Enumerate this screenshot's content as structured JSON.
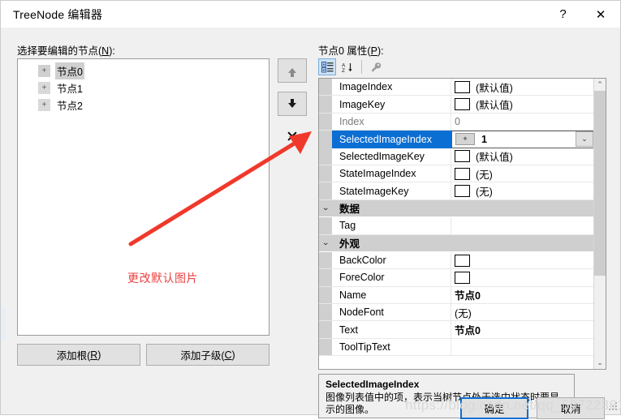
{
  "window": {
    "title": "TreeNode 编辑器",
    "help_label": "?",
    "close_label": "✕"
  },
  "left_pane": {
    "label": "选择要编辑的节点(N):",
    "label_prefix": "选择要编辑的节点(",
    "label_accel": "N",
    "label_suffix": "):",
    "tree_nodes": [
      {
        "label": "节点0",
        "expander": "+",
        "selected": true
      },
      {
        "label": "节点1",
        "expander": "+",
        "selected": false
      },
      {
        "label": "节点2",
        "expander": "+",
        "selected": false
      }
    ],
    "move_up_icon": "arrow-up-icon",
    "move_down_icon": "arrow-down-icon",
    "delete_icon": "x-delete-icon",
    "add_root": {
      "prefix": "添加根(",
      "accel": "R",
      "suffix": ")"
    },
    "add_child": {
      "prefix": "添加子级(",
      "accel": "C",
      "suffix": ")"
    }
  },
  "right_pane": {
    "label_prefix": "节点0 属性(",
    "label_accel": "P",
    "label_suffix": "):",
    "toolbar": {
      "categorized_icon": "categorized-view-icon",
      "alphabetical_icon": "alphabetical-sort-icon",
      "properties_icon": "wrench-properties-icon"
    },
    "rows": [
      {
        "type": "prop",
        "name": "ImageIndex",
        "value": "(默认值)",
        "swatch": true,
        "dim": false
      },
      {
        "type": "prop",
        "name": "ImageKey",
        "value": "(默认值)",
        "swatch": true,
        "dim": false
      },
      {
        "type": "prop",
        "name": "Index",
        "value": "0",
        "swatch": false,
        "dim": true
      },
      {
        "type": "edit",
        "name": "SelectedImageIndex",
        "value": "1",
        "imagebox": true,
        "dropdown": true
      },
      {
        "type": "prop",
        "name": "SelectedImageKey",
        "value": "(默认值)",
        "swatch": true,
        "dim": false
      },
      {
        "type": "prop",
        "name": "StateImageIndex",
        "value": "(无)",
        "swatch": true,
        "dim": false
      },
      {
        "type": "prop",
        "name": "StateImageKey",
        "value": "(无)",
        "swatch": true,
        "dim": false
      },
      {
        "type": "category",
        "name": "数据",
        "chevron": "⌄"
      },
      {
        "type": "prop",
        "name": "Tag",
        "value": "",
        "swatch": false,
        "dim": false
      },
      {
        "type": "category",
        "name": "外观",
        "chevron": "⌄"
      },
      {
        "type": "prop",
        "name": "BackColor",
        "value": "",
        "swatch": true,
        "dim": false
      },
      {
        "type": "prop",
        "name": "ForeColor",
        "value": "",
        "swatch": true,
        "dim": false
      },
      {
        "type": "prop",
        "name": "Name",
        "value": "节点0",
        "swatch": false,
        "dim": false,
        "bold": true
      },
      {
        "type": "prop",
        "name": "NodeFont",
        "value": "(无)",
        "swatch": false,
        "dim": false
      },
      {
        "type": "prop",
        "name": "Text",
        "value": "节点0",
        "swatch": false,
        "dim": false,
        "bold": true
      },
      {
        "type": "prop",
        "name": "ToolTipText",
        "value": "",
        "swatch": false,
        "dim": false
      }
    ],
    "scrollbar": {
      "up": "⌃",
      "down": "⌄"
    },
    "description": {
      "title": "SelectedImageIndex",
      "body": "图像列表值中的项，表示当树节点处于选中状态时要显示的图像。"
    }
  },
  "footer": {
    "ok_label": "确定",
    "cancel_label": "取消"
  },
  "annotation": {
    "text": "更改默认图片",
    "color": "#ec4040",
    "arrow_name": "red-pointer-arrow"
  },
  "watermark": {
    "text": "https://blog.csdn.net/qq_50722361"
  }
}
